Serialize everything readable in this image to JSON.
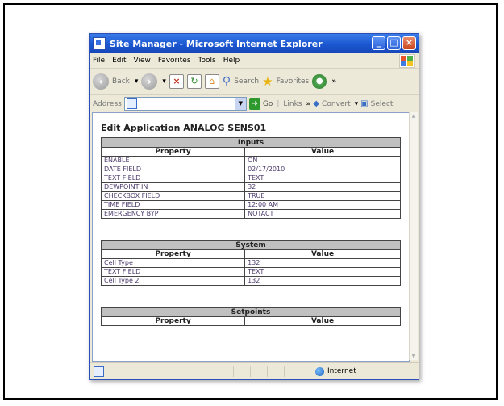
{
  "window": {
    "title": "Site Manager - Microsoft Internet Explorer"
  },
  "menu": [
    "File",
    "Edit",
    "View",
    "Favorites",
    "Tools",
    "Help"
  ],
  "toolbar": {
    "back": "Back",
    "search": "Search",
    "favorites": "Favorites"
  },
  "address": {
    "label": "Address",
    "go": "Go",
    "links": "Links",
    "convert": "Convert",
    "select": "Select"
  },
  "page": {
    "heading": "Edit Application ANALOG SENS01",
    "property_header": "Property",
    "value_header": "Value",
    "sections": [
      {
        "title": "Inputs",
        "rows": [
          [
            "ENABLE",
            "ON"
          ],
          [
            "DATE FIELD",
            "02/17/2010"
          ],
          [
            "TEXT FIELD",
            "TEXT"
          ],
          [
            "DEWPOINT IN",
            "32"
          ],
          [
            "CHECKBOX FIELD",
            "TRUE"
          ],
          [
            "TIME FIELD",
            "12:00 AM"
          ],
          [
            "EMERGENCY BYP",
            "NOTACT"
          ]
        ]
      },
      {
        "title": "System",
        "rows": [
          [
            "Cell Type",
            "132"
          ],
          [
            "TEXT FIELD",
            "TEXT"
          ],
          [
            "Cell Type 2",
            "132"
          ]
        ]
      },
      {
        "title": "Setpoints",
        "rows": []
      }
    ]
  },
  "status": {
    "zone": "Internet"
  }
}
